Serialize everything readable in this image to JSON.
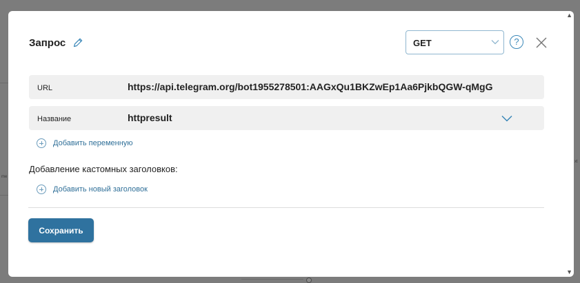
{
  "dialog": {
    "title": "Запрос",
    "method": "GET",
    "help_symbol": "?"
  },
  "fields": {
    "url": {
      "label": "URL",
      "value": "https://api.telegram.org/bot1955278501:AAGxQu1BKZwEp1Aa6PjkbQGW-qMgG"
    },
    "name": {
      "label": "Название",
      "value": "httpresult"
    }
  },
  "actions": {
    "add_variable": "Добавить переменную",
    "custom_headers_heading": "Добавление кастомных заголовков:",
    "add_header": "Добавить новый заголовок",
    "save": "Сохранить"
  },
  "background": {
    "label_left": "me",
    "label_right": "xt"
  },
  "colors": {
    "accent": "#2f729f",
    "link": "#2f6f98",
    "field_bg": "#f0f0f0",
    "overlay": "#7c7c7c"
  }
}
